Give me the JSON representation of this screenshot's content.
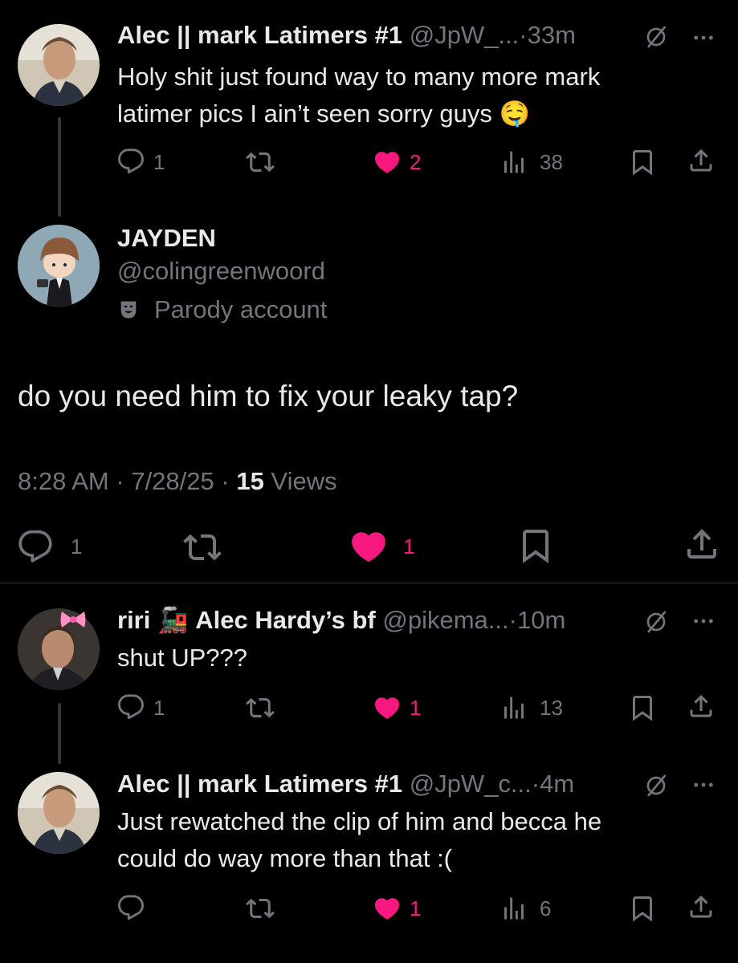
{
  "colors": {
    "background": "#000000",
    "text": "#e7e9ea",
    "muted": "#71767b",
    "like": "#f91880",
    "divider": "#2f3336"
  },
  "tweet1": {
    "name": "Alec || mark Latimers #1",
    "handle": "@JpW_...",
    "sep": "·",
    "time": "33m",
    "text_line1": "Holy shit just found way to many more mark",
    "text_line2": "latimer pics I ain’t seen sorry guys",
    "emoji": "🤤",
    "replies": "1",
    "likes": "2",
    "views": "38"
  },
  "main": {
    "name": "JAYDEN",
    "handle": "@colingreenwoord",
    "badge": "Parody account",
    "text": "do you need him to fix your leaky tap?",
    "time": "8:28 AM",
    "sep1": "·",
    "date": "7/28/25",
    "sep2": "·",
    "views_count": "15",
    "views_label": "Views",
    "replies": "1",
    "likes": "1"
  },
  "reply1": {
    "name_a": "riri",
    "name_emoji": "🚂",
    "name_b": "Alec Hardy’s bf",
    "handle": "@pikema...",
    "sep": "·",
    "time": "10m",
    "text": "shut UP???",
    "replies": "1",
    "likes": "1",
    "views": "13"
  },
  "reply2": {
    "name": "Alec || mark Latimers #1",
    "handle": "@JpW_c...",
    "sep": "·",
    "time": "4m",
    "text_line1": "Just rewatched the clip of him and becca he",
    "text_line2": "could do way more than that :(",
    "likes": "1",
    "views": "6"
  },
  "icons": {
    "more": "more-dots-icon",
    "mute": "slashed-circle-icon",
    "reply": "reply-bubble-icon",
    "retweet": "retweet-icon",
    "like": "heart-icon",
    "views": "views-bars-icon",
    "bookmark": "bookmark-icon",
    "share": "share-icon",
    "parody": "parody-mask-icon"
  }
}
